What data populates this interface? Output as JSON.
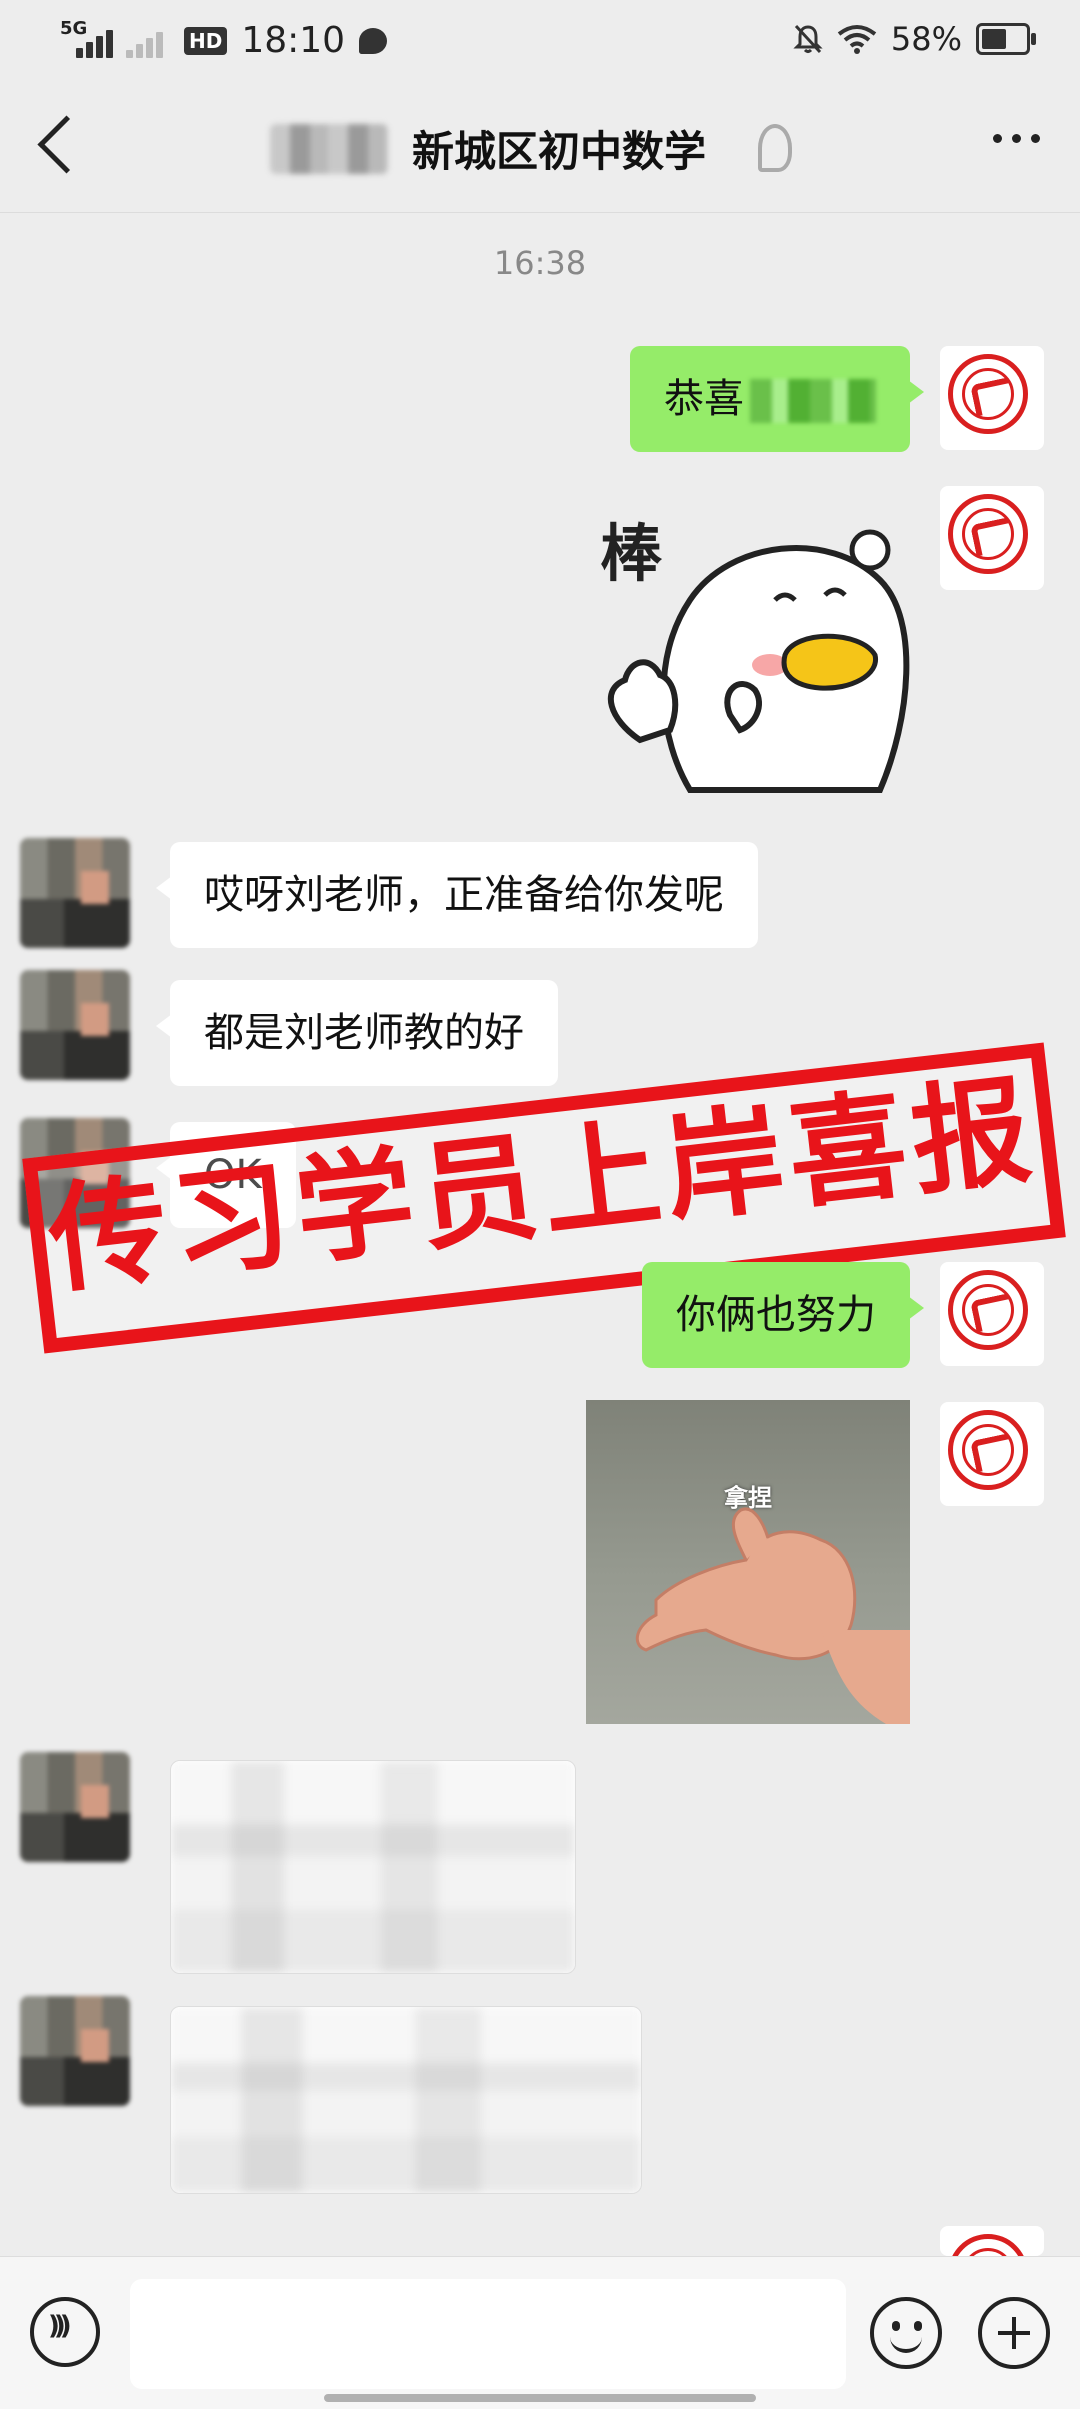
{
  "status_bar": {
    "network": "5G",
    "time": "18:10",
    "battery": "58%",
    "battery_level": 0.58
  },
  "header": {
    "title": "新城区初中数学"
  },
  "timestamp": "16:38",
  "messages": [
    {
      "side": "right",
      "type": "text",
      "text": "恭喜"
    },
    {
      "side": "right",
      "type": "sticker",
      "text": "棒"
    },
    {
      "side": "left",
      "type": "text",
      "text": "哎呀刘老师，正准备给你发呢"
    },
    {
      "side": "left",
      "type": "text",
      "text": "都是刘老师教的好"
    },
    {
      "side": "left",
      "type": "text",
      "text": "OK"
    },
    {
      "side": "right",
      "type": "text",
      "text": "你俩也努力"
    },
    {
      "side": "right",
      "type": "image",
      "caption": "拿捏"
    },
    {
      "side": "left",
      "type": "blurred-card"
    },
    {
      "side": "left",
      "type": "blurred-card"
    }
  ],
  "overlay": {
    "stamp_text": "传习学员上岸喜报",
    "stamp_color": "#e8141a"
  },
  "colors": {
    "sent_bubble": "#95ec69",
    "received_bubble": "#ffffff",
    "background": "#ededed"
  },
  "icons": {
    "voice": "voice-icon",
    "emoji": "emoji-icon",
    "plus": "plus-icon",
    "back": "back-icon",
    "more": "more-icon"
  }
}
